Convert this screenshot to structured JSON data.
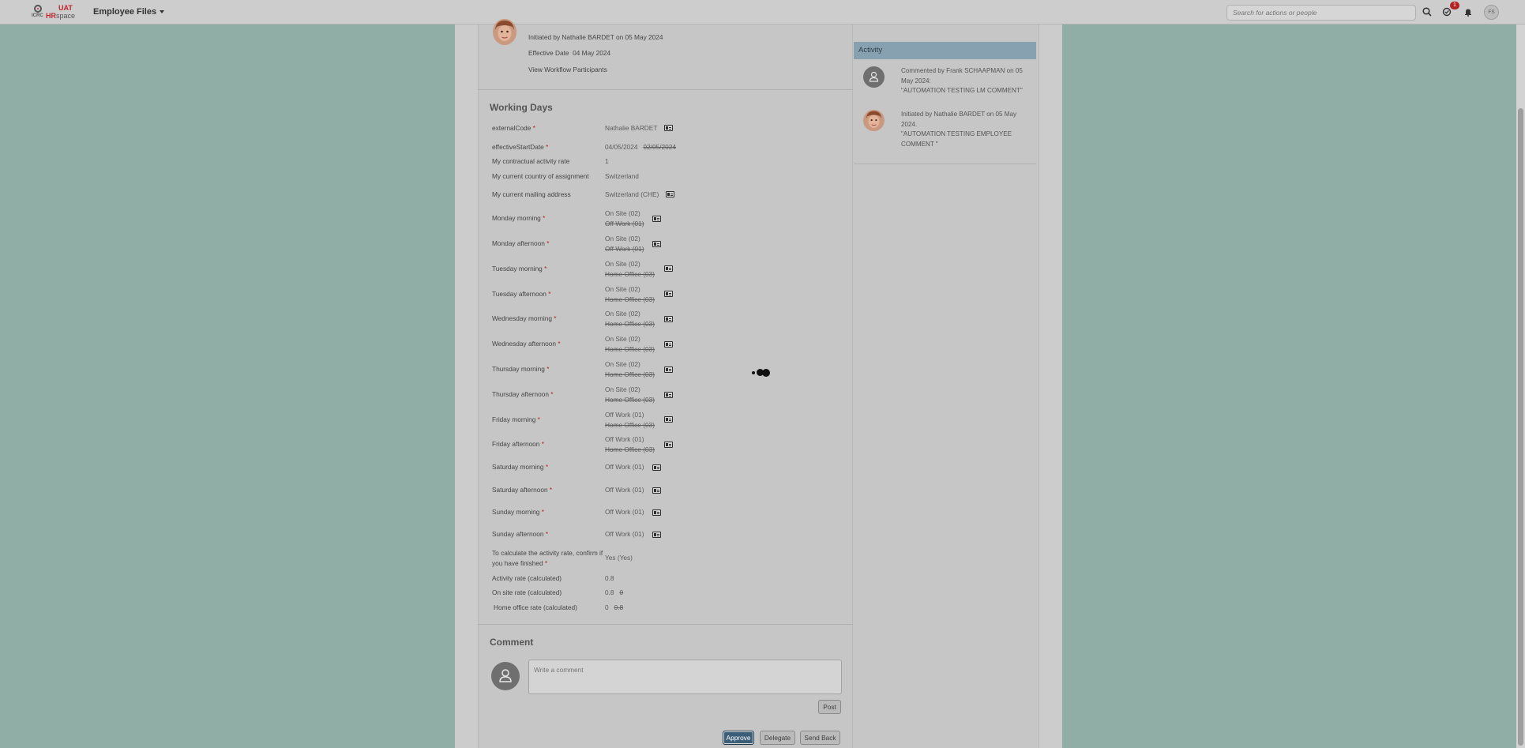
{
  "shellbar": {
    "logo_small": "ICRC",
    "logo_env": "UAT",
    "logo_hr": "HR",
    "logo_space": "space",
    "module": "Employee Files",
    "search_placeholder": "Search for actions or people",
    "notification_count": "1",
    "user_initials": "FS"
  },
  "request": {
    "initiated": "Initiated by Nathalie BARDET on 05 May 2024",
    "effective_label": "Effective Date",
    "effective_date": "04 May 2024",
    "participants_link": "View Workflow Participants"
  },
  "working_days": {
    "title": "Working Days",
    "fields": [
      {
        "label": "externalCode",
        "required": true,
        "value": "Nathalie BARDET",
        "old": ""
      },
      {
        "label": "effectiveStartDate",
        "required": true,
        "value": "04/05/2024",
        "old": "02/05/2024"
      },
      {
        "label": "My contractual activity rate",
        "required": false,
        "value": "1",
        "old": ""
      },
      {
        "label": "My current country of assignment",
        "required": false,
        "value": "Switzerland",
        "old": ""
      },
      {
        "label": "My current mailing address",
        "required": false,
        "value": "Switzerland (CHE)",
        "old": ""
      },
      {
        "label": "Monday morning",
        "required": true,
        "value": "On Site (02)",
        "old": "Off Work (01)"
      },
      {
        "label": "Monday afternoon",
        "required": true,
        "value": "On Site (02)",
        "old": "Off Work (01)"
      },
      {
        "label": "Tuesday morning",
        "required": true,
        "value": "On Site (02)",
        "old": "Home Office (03)"
      },
      {
        "label": "Tuesday afternoon",
        "required": true,
        "value": "On Site (02)",
        "old": "Home Office (03)"
      },
      {
        "label": "Wednesday morning",
        "required": true,
        "value": "On Site (02)",
        "old": "Home Office (03)"
      },
      {
        "label": "Wednesday afternoon",
        "required": true,
        "value": "On Site (02)",
        "old": "Home Office (03)"
      },
      {
        "label": "Thursday morning",
        "required": true,
        "value": "On Site (02)",
        "old": "Home Office (03)"
      },
      {
        "label": "Thursday afternoon",
        "required": true,
        "value": "On Site (02)",
        "old": "Home Office (03)"
      },
      {
        "label": "Friday morning",
        "required": true,
        "value": "Off Work (01)",
        "old": "Home Office (03)"
      },
      {
        "label": "Friday afternoon",
        "required": true,
        "value": "Off Work (01)",
        "old": "Home Office (03)"
      },
      {
        "label": "Saturday morning",
        "required": true,
        "value": "Off Work (01)",
        "old": ""
      },
      {
        "label": "Saturday afternoon",
        "required": true,
        "value": "Off Work (01)",
        "old": ""
      },
      {
        "label": "Sunday morning",
        "required": true,
        "value": "Off Work (01)",
        "old": ""
      },
      {
        "label": "Sunday afternoon",
        "required": true,
        "value": "Off Work (01)",
        "old": ""
      },
      {
        "label": "To calculate the activity rate, confirm if you have finished",
        "required": true,
        "value": "Yes (Yes)",
        "old": ""
      },
      {
        "label": "Activity rate (calculated)",
        "required": false,
        "value": "0.8",
        "old": ""
      },
      {
        "label": "On site rate (calculated)",
        "required": false,
        "value": "0.8",
        "old": "0"
      },
      {
        "label": "Home office rate (calculated)",
        "required": false,
        "value": "0",
        "old": "0.8"
      }
    ]
  },
  "comment": {
    "title": "Comment",
    "placeholder": "Write a comment",
    "post": "Post"
  },
  "actions": {
    "approve": "Approve",
    "delegate": "Delegate",
    "send_back": "Send Back"
  },
  "activity": {
    "title": "Activity",
    "items": [
      {
        "lines": [
          "Commented by Frank SCHAAPMAN on 05",
          "May 2024:",
          "\"AUTOMATION TESTING LM COMMENT\""
        ]
      },
      {
        "lines": [
          "Initiated by Nathalie BARDET on 05 May",
          "2024.",
          "\"AUTOMATION TESTING EMPLOYEE",
          "COMMENT \""
        ]
      }
    ]
  },
  "icons": {
    "module_menu": "chevron-down-icon",
    "search": "search-icon",
    "tasks": "tasks-icon",
    "notifications": "bell-icon",
    "history": "history-icon",
    "user": "user-icon",
    "busy": "busy-indicator"
  }
}
